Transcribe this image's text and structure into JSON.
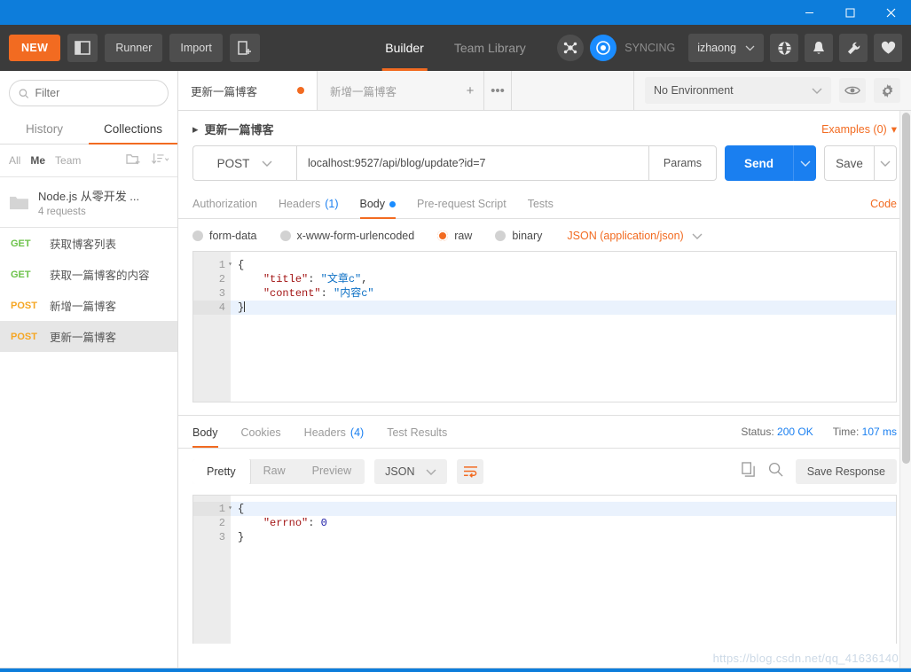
{
  "window": {
    "minimize": "–",
    "maximize": "□",
    "close": "✕"
  },
  "toolbar": {
    "new_label": "NEW",
    "sidebar_toggle_icon": "panel-icon",
    "runner_label": "Runner",
    "import_label": "Import",
    "new_window_icon": "new-window-icon",
    "tabs": [
      {
        "label": "Builder",
        "active": true
      },
      {
        "label": "Team Library",
        "active": false
      }
    ],
    "interceptor_icon": "interceptor-icon",
    "sync_icon": "sync-icon",
    "sync_label": "SYNCING",
    "user_label": "izhaong",
    "globe_icon": "globe-icon",
    "bell_icon": "bell-icon",
    "wrench_icon": "wrench-icon",
    "heart_icon": "heart-icon"
  },
  "sidebar": {
    "filter_placeholder": "Filter",
    "search_icon": "search-icon",
    "tabs": [
      {
        "label": "History",
        "active": false
      },
      {
        "label": "Collections",
        "active": true
      }
    ],
    "scopes": [
      {
        "label": "All",
        "selected": false
      },
      {
        "label": "Me",
        "selected": true
      },
      {
        "label": "Team",
        "selected": false
      }
    ],
    "new_folder_icon": "new-folder-icon",
    "sort_icon": "sort-icon",
    "collection": {
      "folder_icon": "folder-icon",
      "name": "Node.js 从零开发 ...",
      "count": "4 requests"
    },
    "requests": [
      {
        "method": "GET",
        "name": "获取博客列表",
        "active": false
      },
      {
        "method": "GET",
        "name": "获取一篇博客的内容",
        "active": false
      },
      {
        "method": "POST",
        "name": "新增一篇博客",
        "active": false
      },
      {
        "method": "POST",
        "name": "更新一篇博客",
        "active": true
      }
    ]
  },
  "tabstrip": {
    "tabs": [
      {
        "label": "更新一篇博客",
        "active": true,
        "unsaved": true
      },
      {
        "label": "新增一篇博客",
        "active": false,
        "unsaved": false
      }
    ],
    "plus": "+",
    "more": "•••"
  },
  "environment": {
    "selected": "No Environment",
    "caret": "⌄",
    "eye_icon": "eye-icon",
    "gear_icon": "gear-icon"
  },
  "request": {
    "title": "更新一篇博客",
    "collapse_caret": "▸",
    "examples_label": "Examples (0)",
    "examples_caret": "▾",
    "method": "POST",
    "method_caret": "⌄",
    "url": "localhost:9527/api/blog/update?id=7",
    "params_label": "Params",
    "send_label": "Send",
    "send_caret": "⌄",
    "save_label": "Save",
    "save_caret": "⌄",
    "tabs": [
      {
        "label": "Authorization",
        "active": false,
        "count": "",
        "dot": false
      },
      {
        "label": "Headers",
        "active": false,
        "count": "(1)",
        "dot": false
      },
      {
        "label": "Body",
        "active": true,
        "count": "",
        "dot": true
      },
      {
        "label": "Pre-request Script",
        "active": false,
        "count": "",
        "dot": false
      },
      {
        "label": "Tests",
        "active": false,
        "count": "",
        "dot": false
      }
    ],
    "code_label": "Code",
    "body_types": [
      {
        "label": "form-data",
        "selected": false
      },
      {
        "label": "x-www-form-urlencoded",
        "selected": false
      },
      {
        "label": "raw",
        "selected": true
      },
      {
        "label": "binary",
        "selected": false
      }
    ],
    "raw_format": "JSON (application/json)",
    "raw_format_caret": "⌄",
    "body_lines": [
      {
        "num": "1",
        "fold": "▾",
        "highlight": false,
        "tokens": [
          {
            "t": "{",
            "c": "p"
          }
        ]
      },
      {
        "num": "2",
        "fold": "",
        "highlight": false,
        "tokens": [
          {
            "t": "    ",
            "c": "p"
          },
          {
            "t": "\"title\"",
            "c": "k"
          },
          {
            "t": ": ",
            "c": "p"
          },
          {
            "t": "\"文章c\"",
            "c": "s"
          },
          {
            "t": ",",
            "c": "p"
          }
        ]
      },
      {
        "num": "3",
        "fold": "",
        "highlight": false,
        "tokens": [
          {
            "t": "    ",
            "c": "p"
          },
          {
            "t": "\"content\"",
            "c": "k"
          },
          {
            "t": ": ",
            "c": "p"
          },
          {
            "t": "\"内容c\"",
            "c": "s"
          }
        ]
      },
      {
        "num": "4",
        "fold": "",
        "highlight": true,
        "tokens": [
          {
            "t": "}",
            "c": "p"
          }
        ]
      }
    ]
  },
  "response": {
    "tabs": [
      {
        "label": "Body",
        "active": true,
        "count": ""
      },
      {
        "label": "Cookies",
        "active": false,
        "count": ""
      },
      {
        "label": "Headers",
        "active": false,
        "count": "(4)"
      },
      {
        "label": "Test Results",
        "active": false,
        "count": ""
      }
    ],
    "status_label": "Status:",
    "status_value": "200 OK",
    "time_label": "Time:",
    "time_value": "107 ms",
    "view_modes": [
      {
        "label": "Pretty",
        "active": true
      },
      {
        "label": "Raw",
        "active": false
      },
      {
        "label": "Preview",
        "active": false
      }
    ],
    "format": "JSON",
    "format_caret": "⌄",
    "wrap_icon": "word-wrap-icon",
    "copy_icon": "copy-icon",
    "search_icon": "search-icon",
    "save_response_label": "Save Response",
    "body_lines": [
      {
        "num": "1",
        "fold": "▾",
        "highlight": true,
        "tokens": [
          {
            "t": "{",
            "c": "p"
          }
        ]
      },
      {
        "num": "2",
        "fold": "",
        "highlight": false,
        "tokens": [
          {
            "t": "    ",
            "c": "p"
          },
          {
            "t": "\"errno\"",
            "c": "k"
          },
          {
            "t": ": ",
            "c": "p"
          },
          {
            "t": "0",
            "c": "n"
          }
        ]
      },
      {
        "num": "3",
        "fold": "",
        "highlight": false,
        "tokens": [
          {
            "t": "}",
            "c": "p"
          }
        ]
      }
    ]
  },
  "watermark": "https://blog.csdn.net/qq_41636140",
  "colors": {
    "titlebar": "#0d7ddb",
    "toolbar": "#3b3b3b",
    "accent_orange": "#f26b21",
    "accent_blue": "#1a7ff0",
    "get_green": "#6cc24a",
    "post_orange": "#f5a623"
  }
}
